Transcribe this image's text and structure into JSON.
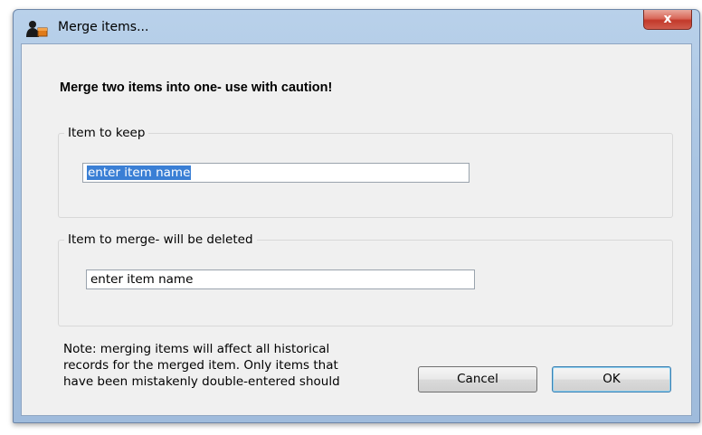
{
  "window": {
    "title": "Merge items...",
    "close_label": "x"
  },
  "dialog": {
    "heading": "Merge two items into one- use with caution!",
    "keep_group": {
      "label": "Item to keep",
      "input_value": "enter item name"
    },
    "merge_group": {
      "label": "Item to merge- will be deleted",
      "input_value": "enter item name"
    },
    "note_lines": [
      "Note: merging items will affect all historical",
      "records for the merged item. Only items that",
      "have been mistakenly double-entered should"
    ],
    "cancel_label": "Cancel",
    "ok_label": "OK"
  },
  "icons": {
    "app": "person-with-box-icon",
    "close": "close-icon"
  }
}
